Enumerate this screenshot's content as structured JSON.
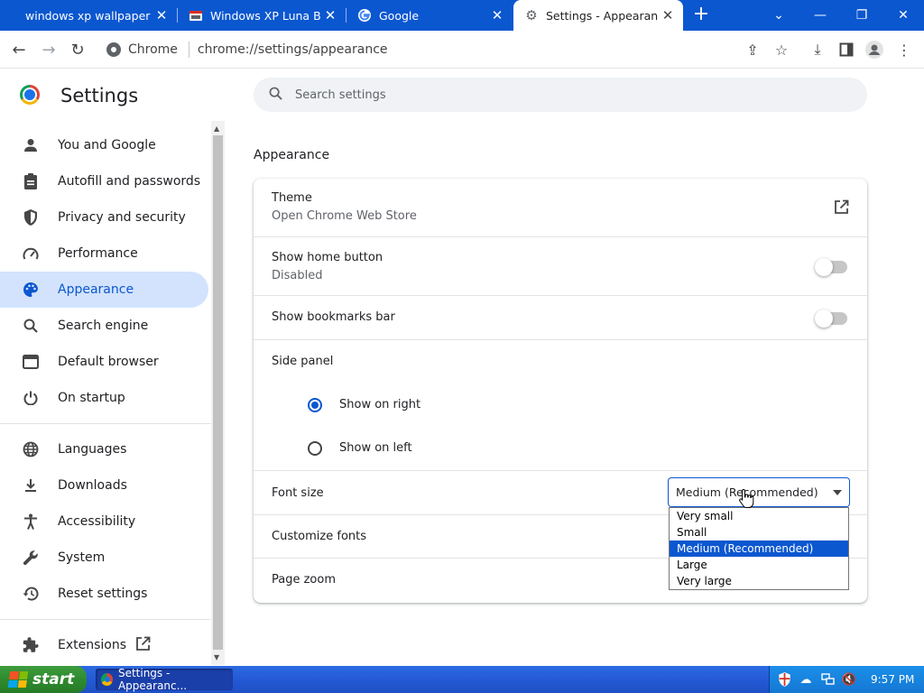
{
  "tabs": [
    {
      "title": "windows xp wallpaper",
      "close": "✕"
    },
    {
      "title": "Windows XP Luna Blue",
      "close": "✕"
    },
    {
      "title": "Google",
      "close": "✕"
    },
    {
      "title": "Settings - Appearance",
      "close": "✕"
    }
  ],
  "toolbar": {
    "chip_label": "Chrome",
    "url": "chrome://settings/appearance"
  },
  "sidebar": {
    "title": "Settings",
    "items": [
      {
        "label": "You and Google",
        "icon": "person-icon"
      },
      {
        "label": "Autofill and passwords",
        "icon": "clipboard-icon"
      },
      {
        "label": "Privacy and security",
        "icon": "shield-icon"
      },
      {
        "label": "Performance",
        "icon": "gauge-icon"
      },
      {
        "label": "Appearance",
        "icon": "palette-icon"
      },
      {
        "label": "Search engine",
        "icon": "search-icon"
      },
      {
        "label": "Default browser",
        "icon": "browser-icon"
      },
      {
        "label": "On startup",
        "icon": "power-icon"
      },
      {
        "label": "Languages",
        "icon": "globe-icon"
      },
      {
        "label": "Downloads",
        "icon": "download-icon"
      },
      {
        "label": "Accessibility",
        "icon": "accessibility-icon"
      },
      {
        "label": "System",
        "icon": "wrench-icon"
      },
      {
        "label": "Reset settings",
        "icon": "restore-icon"
      },
      {
        "label": "Extensions",
        "icon": "puzzle-icon"
      }
    ]
  },
  "search": {
    "placeholder": "Search settings"
  },
  "appearance": {
    "section_title": "Appearance",
    "theme_label": "Theme",
    "theme_sub": "Open Chrome Web Store",
    "home_label": "Show home button",
    "home_sub": "Disabled",
    "bookmarks_label": "Show bookmarks bar",
    "side_panel_label": "Side panel",
    "side_right": "Show on right",
    "side_left": "Show on left",
    "font_size_label": "Font size",
    "font_size_value": "Medium (Recommended)",
    "font_options": [
      "Very small",
      "Small",
      "Medium (Recommended)",
      "Large",
      "Very large"
    ],
    "customize_fonts_label": "Customize fonts",
    "page_zoom_label": "Page zoom"
  },
  "taskbar": {
    "start_label": "start",
    "task_label": "Settings - Appearanc...",
    "clock": "9:57 PM"
  },
  "colors": {
    "accent": "#0b57d0",
    "tabstrip": "#0b57d0",
    "nav_active_bg": "#d3e3fd",
    "xp_taskbar": "#245ad6",
    "xp_start": "#2f8a2f"
  }
}
